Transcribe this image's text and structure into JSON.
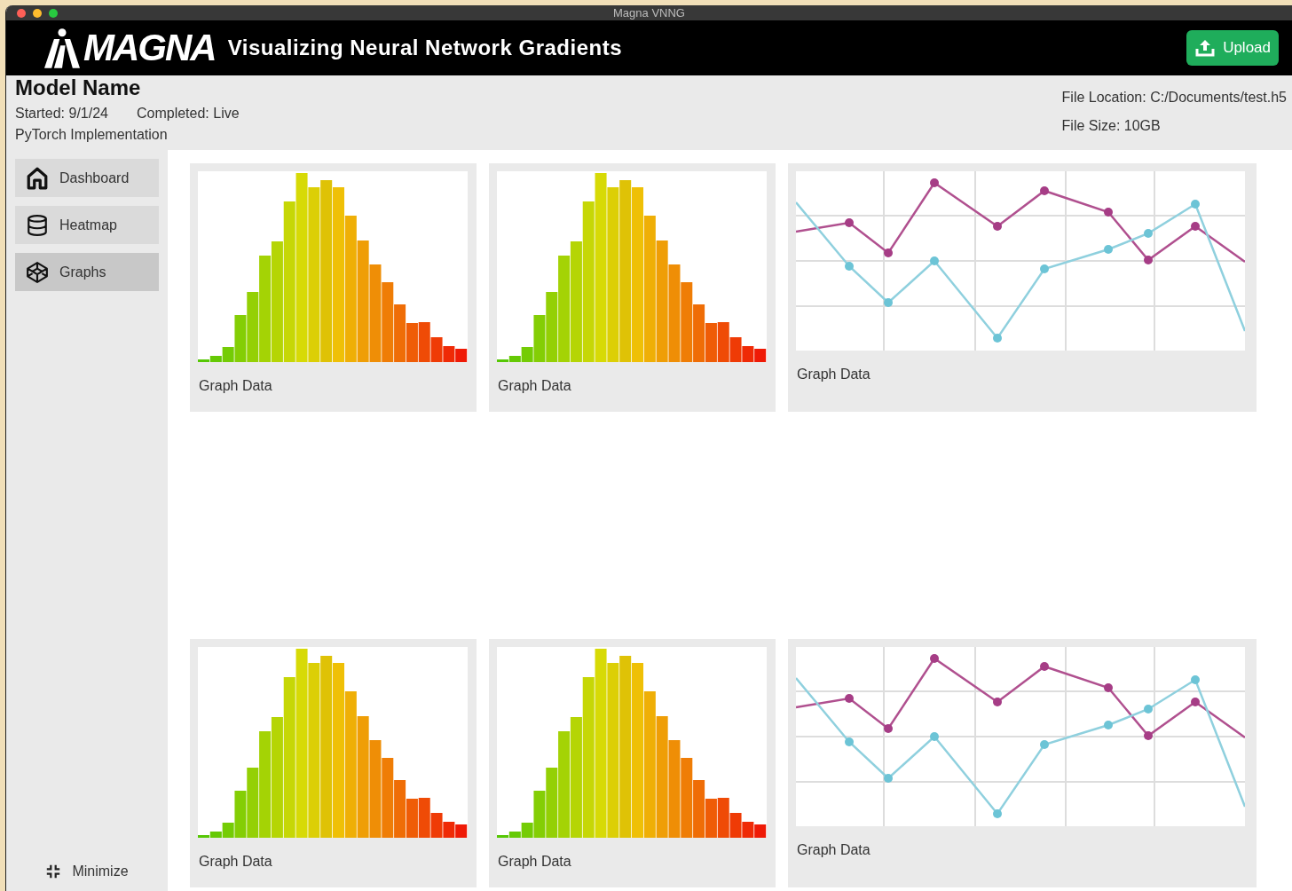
{
  "window": {
    "title": "Magna VNNG"
  },
  "header": {
    "logo_text": "MAGNA",
    "title": "Visualizing Neural Network Gradients",
    "upload_button": "Upload"
  },
  "model": {
    "name": "Model Name",
    "started": "Started: 9/1/24",
    "completed": "Completed: Live",
    "implementation": "PyTorch Implementation",
    "file_location": "File Location: C:/Documents/test.h5",
    "file_size": "File Size: 10GB"
  },
  "sidebar": {
    "items": [
      {
        "kind": "home",
        "label": "Dashboard",
        "selected": false
      },
      {
        "kind": "database",
        "label": "Heatmap",
        "selected": false
      },
      {
        "kind": "cube",
        "label": "Graphs",
        "selected": true
      }
    ],
    "minimize": "Minimize"
  },
  "cards": [
    {
      "kind": "histogram",
      "caption": "Graph Data"
    },
    {
      "kind": "histogram",
      "caption": "Graph Data"
    },
    {
      "kind": "line",
      "caption": "Graph Data"
    },
    {
      "kind": "histogram",
      "caption": "Graph Data"
    },
    {
      "kind": "histogram",
      "caption": "Graph Data"
    },
    {
      "kind": "line",
      "caption": "Graph Data"
    }
  ]
}
